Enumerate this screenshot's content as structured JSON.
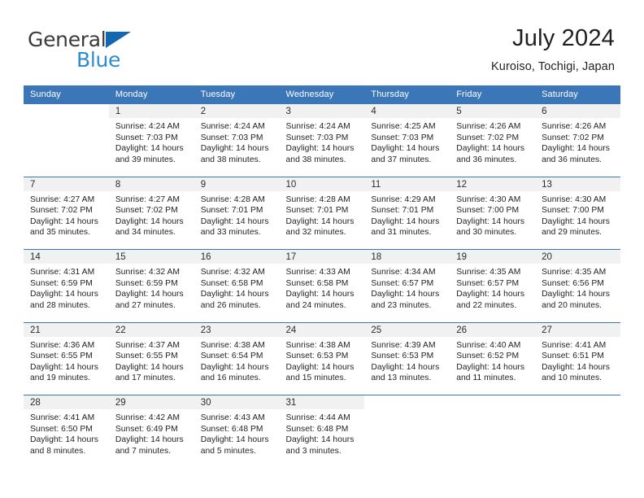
{
  "brand": {
    "name_part1": "General",
    "name_part2": "Blue",
    "triangle_icon": "triangle-icon",
    "accent_color": "#1167b1",
    "secondary_color": "#2e8bd0"
  },
  "header": {
    "title": "July 2024",
    "subtitle": "Kuroiso, Tochigi, Japan"
  },
  "theme": {
    "header_blue": "#3b77b8",
    "daynum_band": "#f1f1f1",
    "text": "#1f1f1f"
  },
  "weekdays": [
    "Sunday",
    "Monday",
    "Tuesday",
    "Wednesday",
    "Thursday",
    "Friday",
    "Saturday"
  ],
  "weeks": [
    [
      {
        "day": "",
        "sunrise": "",
        "sunset": "",
        "daylight_line1": "",
        "daylight_line2": ""
      },
      {
        "day": "1",
        "sunrise": "Sunrise: 4:24 AM",
        "sunset": "Sunset: 7:03 PM",
        "daylight_line1": "Daylight: 14 hours",
        "daylight_line2": "and 39 minutes."
      },
      {
        "day": "2",
        "sunrise": "Sunrise: 4:24 AM",
        "sunset": "Sunset: 7:03 PM",
        "daylight_line1": "Daylight: 14 hours",
        "daylight_line2": "and 38 minutes."
      },
      {
        "day": "3",
        "sunrise": "Sunrise: 4:24 AM",
        "sunset": "Sunset: 7:03 PM",
        "daylight_line1": "Daylight: 14 hours",
        "daylight_line2": "and 38 minutes."
      },
      {
        "day": "4",
        "sunrise": "Sunrise: 4:25 AM",
        "sunset": "Sunset: 7:03 PM",
        "daylight_line1": "Daylight: 14 hours",
        "daylight_line2": "and 37 minutes."
      },
      {
        "day": "5",
        "sunrise": "Sunrise: 4:26 AM",
        "sunset": "Sunset: 7:02 PM",
        "daylight_line1": "Daylight: 14 hours",
        "daylight_line2": "and 36 minutes."
      },
      {
        "day": "6",
        "sunrise": "Sunrise: 4:26 AM",
        "sunset": "Sunset: 7:02 PM",
        "daylight_line1": "Daylight: 14 hours",
        "daylight_line2": "and 36 minutes."
      }
    ],
    [
      {
        "day": "7",
        "sunrise": "Sunrise: 4:27 AM",
        "sunset": "Sunset: 7:02 PM",
        "daylight_line1": "Daylight: 14 hours",
        "daylight_line2": "and 35 minutes."
      },
      {
        "day": "8",
        "sunrise": "Sunrise: 4:27 AM",
        "sunset": "Sunset: 7:02 PM",
        "daylight_line1": "Daylight: 14 hours",
        "daylight_line2": "and 34 minutes."
      },
      {
        "day": "9",
        "sunrise": "Sunrise: 4:28 AM",
        "sunset": "Sunset: 7:01 PM",
        "daylight_line1": "Daylight: 14 hours",
        "daylight_line2": "and 33 minutes."
      },
      {
        "day": "10",
        "sunrise": "Sunrise: 4:28 AM",
        "sunset": "Sunset: 7:01 PM",
        "daylight_line1": "Daylight: 14 hours",
        "daylight_line2": "and 32 minutes."
      },
      {
        "day": "11",
        "sunrise": "Sunrise: 4:29 AM",
        "sunset": "Sunset: 7:01 PM",
        "daylight_line1": "Daylight: 14 hours",
        "daylight_line2": "and 31 minutes."
      },
      {
        "day": "12",
        "sunrise": "Sunrise: 4:30 AM",
        "sunset": "Sunset: 7:00 PM",
        "daylight_line1": "Daylight: 14 hours",
        "daylight_line2": "and 30 minutes."
      },
      {
        "day": "13",
        "sunrise": "Sunrise: 4:30 AM",
        "sunset": "Sunset: 7:00 PM",
        "daylight_line1": "Daylight: 14 hours",
        "daylight_line2": "and 29 minutes."
      }
    ],
    [
      {
        "day": "14",
        "sunrise": "Sunrise: 4:31 AM",
        "sunset": "Sunset: 6:59 PM",
        "daylight_line1": "Daylight: 14 hours",
        "daylight_line2": "and 28 minutes."
      },
      {
        "day": "15",
        "sunrise": "Sunrise: 4:32 AM",
        "sunset": "Sunset: 6:59 PM",
        "daylight_line1": "Daylight: 14 hours",
        "daylight_line2": "and 27 minutes."
      },
      {
        "day": "16",
        "sunrise": "Sunrise: 4:32 AM",
        "sunset": "Sunset: 6:58 PM",
        "daylight_line1": "Daylight: 14 hours",
        "daylight_line2": "and 26 minutes."
      },
      {
        "day": "17",
        "sunrise": "Sunrise: 4:33 AM",
        "sunset": "Sunset: 6:58 PM",
        "daylight_line1": "Daylight: 14 hours",
        "daylight_line2": "and 24 minutes."
      },
      {
        "day": "18",
        "sunrise": "Sunrise: 4:34 AM",
        "sunset": "Sunset: 6:57 PM",
        "daylight_line1": "Daylight: 14 hours",
        "daylight_line2": "and 23 minutes."
      },
      {
        "day": "19",
        "sunrise": "Sunrise: 4:35 AM",
        "sunset": "Sunset: 6:57 PM",
        "daylight_line1": "Daylight: 14 hours",
        "daylight_line2": "and 22 minutes."
      },
      {
        "day": "20",
        "sunrise": "Sunrise: 4:35 AM",
        "sunset": "Sunset: 6:56 PM",
        "daylight_line1": "Daylight: 14 hours",
        "daylight_line2": "and 20 minutes."
      }
    ],
    [
      {
        "day": "21",
        "sunrise": "Sunrise: 4:36 AM",
        "sunset": "Sunset: 6:55 PM",
        "daylight_line1": "Daylight: 14 hours",
        "daylight_line2": "and 19 minutes."
      },
      {
        "day": "22",
        "sunrise": "Sunrise: 4:37 AM",
        "sunset": "Sunset: 6:55 PM",
        "daylight_line1": "Daylight: 14 hours",
        "daylight_line2": "and 17 minutes."
      },
      {
        "day": "23",
        "sunrise": "Sunrise: 4:38 AM",
        "sunset": "Sunset: 6:54 PM",
        "daylight_line1": "Daylight: 14 hours",
        "daylight_line2": "and 16 minutes."
      },
      {
        "day": "24",
        "sunrise": "Sunrise: 4:38 AM",
        "sunset": "Sunset: 6:53 PM",
        "daylight_line1": "Daylight: 14 hours",
        "daylight_line2": "and 15 minutes."
      },
      {
        "day": "25",
        "sunrise": "Sunrise: 4:39 AM",
        "sunset": "Sunset: 6:53 PM",
        "daylight_line1": "Daylight: 14 hours",
        "daylight_line2": "and 13 minutes."
      },
      {
        "day": "26",
        "sunrise": "Sunrise: 4:40 AM",
        "sunset": "Sunset: 6:52 PM",
        "daylight_line1": "Daylight: 14 hours",
        "daylight_line2": "and 11 minutes."
      },
      {
        "day": "27",
        "sunrise": "Sunrise: 4:41 AM",
        "sunset": "Sunset: 6:51 PM",
        "daylight_line1": "Daylight: 14 hours",
        "daylight_line2": "and 10 minutes."
      }
    ],
    [
      {
        "day": "28",
        "sunrise": "Sunrise: 4:41 AM",
        "sunset": "Sunset: 6:50 PM",
        "daylight_line1": "Daylight: 14 hours",
        "daylight_line2": "and 8 minutes."
      },
      {
        "day": "29",
        "sunrise": "Sunrise: 4:42 AM",
        "sunset": "Sunset: 6:49 PM",
        "daylight_line1": "Daylight: 14 hours",
        "daylight_line2": "and 7 minutes."
      },
      {
        "day": "30",
        "sunrise": "Sunrise: 4:43 AM",
        "sunset": "Sunset: 6:48 PM",
        "daylight_line1": "Daylight: 14 hours",
        "daylight_line2": "and 5 minutes."
      },
      {
        "day": "31",
        "sunrise": "Sunrise: 4:44 AM",
        "sunset": "Sunset: 6:48 PM",
        "daylight_line1": "Daylight: 14 hours",
        "daylight_line2": "and 3 minutes."
      },
      {
        "day": "",
        "sunrise": "",
        "sunset": "",
        "daylight_line1": "",
        "daylight_line2": ""
      },
      {
        "day": "",
        "sunrise": "",
        "sunset": "",
        "daylight_line1": "",
        "daylight_line2": ""
      },
      {
        "day": "",
        "sunrise": "",
        "sunset": "",
        "daylight_line1": "",
        "daylight_line2": ""
      }
    ]
  ]
}
